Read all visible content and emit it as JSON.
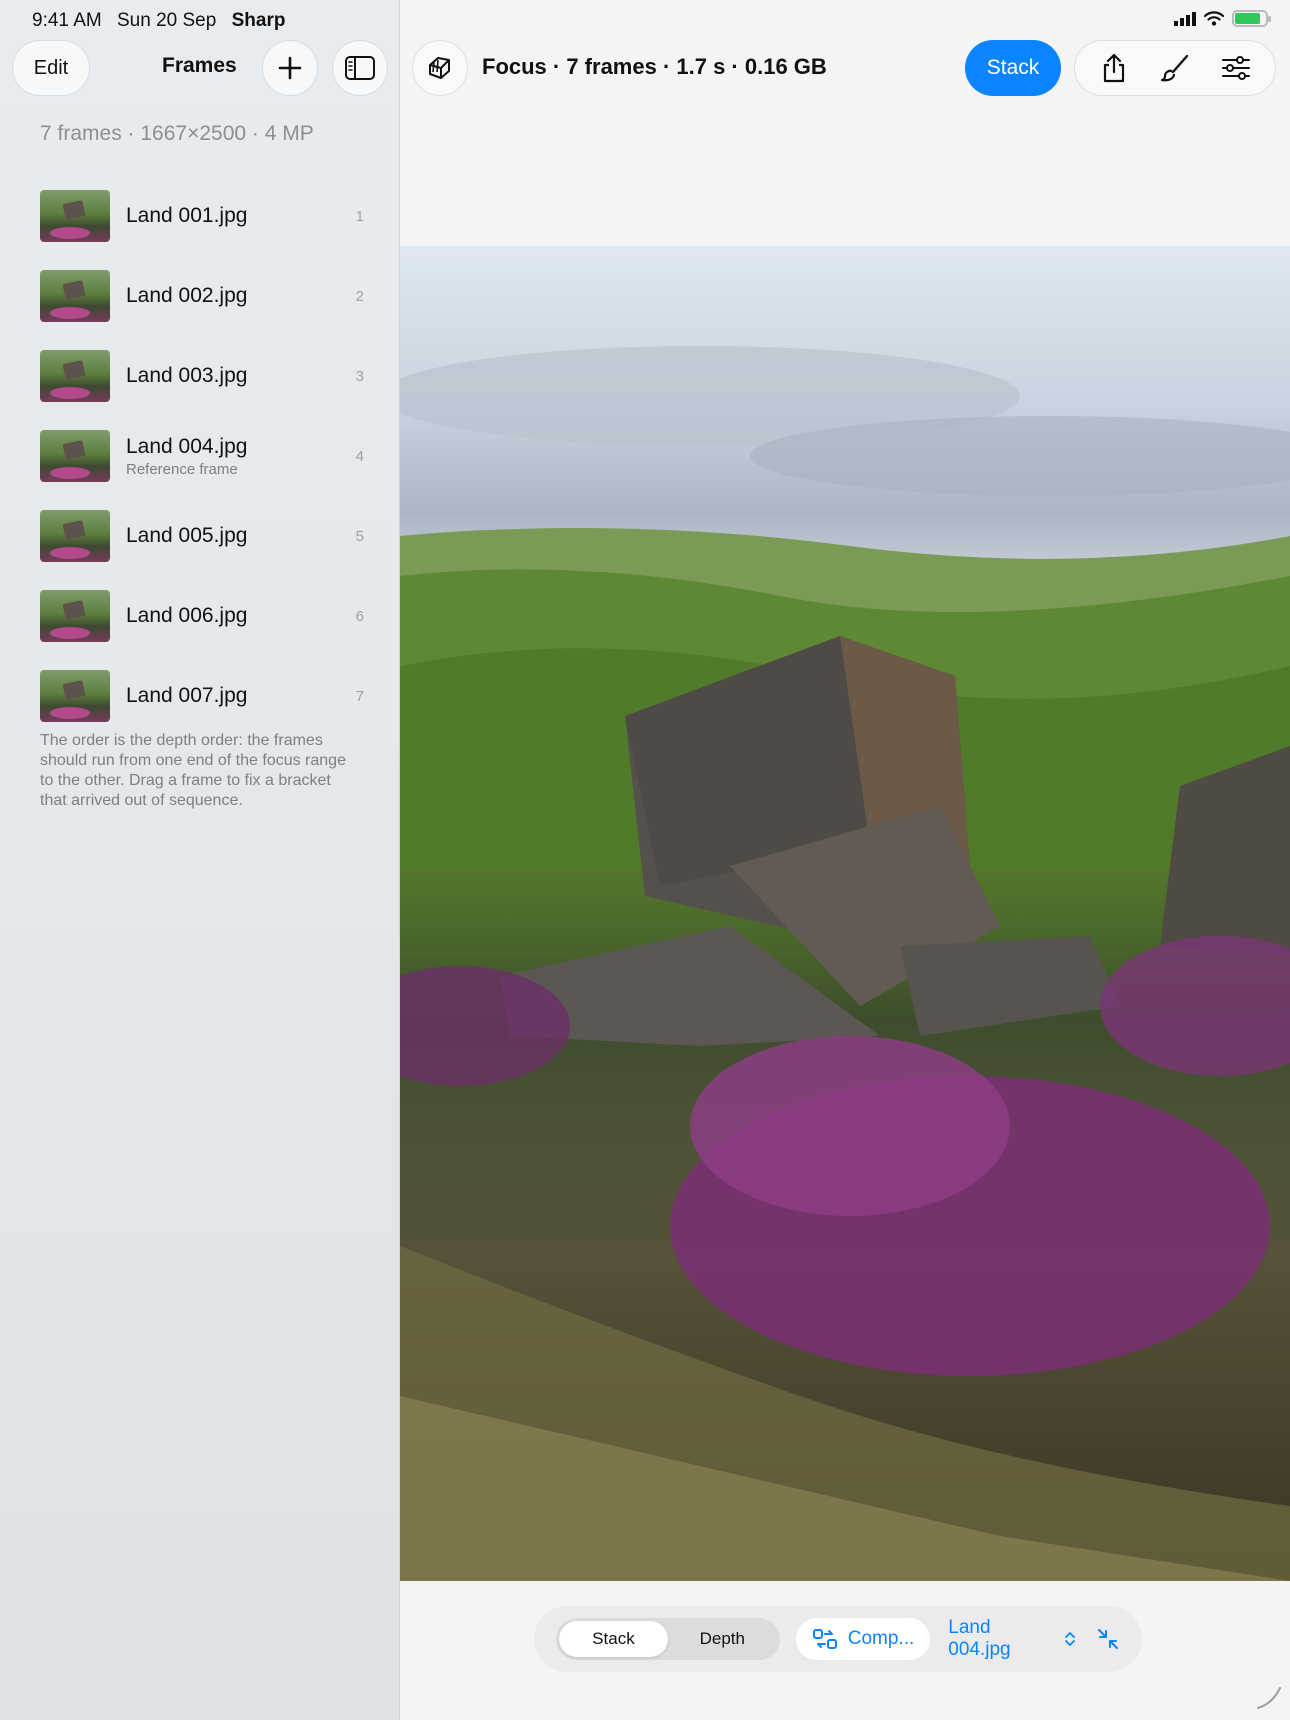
{
  "status_bar": {
    "time": "9:41 AM",
    "date": "Sun 20 Sep",
    "carrier": "Sharp"
  },
  "sidebar": {
    "edit_label": "Edit",
    "title": "Frames",
    "summary": "7 frames · 1667×2500 · 4 MP",
    "frames": [
      {
        "name": "Land 001.jpg",
        "subtitle": "",
        "index": "1"
      },
      {
        "name": "Land 002.jpg",
        "subtitle": "",
        "index": "2"
      },
      {
        "name": "Land 003.jpg",
        "subtitle": "",
        "index": "3"
      },
      {
        "name": "Land 004.jpg",
        "subtitle": "Reference frame",
        "index": "4"
      },
      {
        "name": "Land 005.jpg",
        "subtitle": "",
        "index": "5"
      },
      {
        "name": "Land 006.jpg",
        "subtitle": "",
        "index": "6"
      },
      {
        "name": "Land 007.jpg",
        "subtitle": "",
        "index": "7"
      }
    ],
    "note": "The order is the depth order: the frames should run from one end of the focus range to the other. Drag a frame to fix a bracket that arrived out of sequence."
  },
  "toolbar": {
    "title": "Focus · 7 frames · 1.7 s · 0.16 GB",
    "stack_label": "Stack"
  },
  "bottom_bar": {
    "segments": [
      "Stack",
      "Depth"
    ],
    "selected_segment": "Stack",
    "compare_label": "Comp...",
    "reference_value": "Land 004.jpg"
  },
  "colors": {
    "accent": "#0a84ff",
    "battery": "#32c759"
  },
  "icons": [
    "stack-app-icon",
    "share-icon",
    "brush-icon",
    "sliders-icon",
    "plus-icon",
    "sidebar-toggle-icon",
    "compare-icon",
    "chevron-updown-icon",
    "collapse-arrows-icon"
  ]
}
